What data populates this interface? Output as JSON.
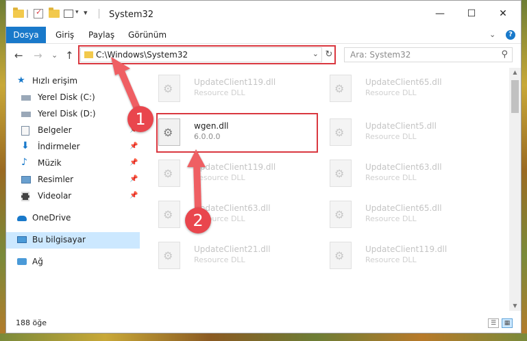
{
  "window": {
    "title": "System32",
    "controls": {
      "minimize": "—",
      "maximize": "☐",
      "close": "✕"
    }
  },
  "ribbon": {
    "tabs": [
      {
        "label": "Dosya",
        "active": true
      },
      {
        "label": "Giriş"
      },
      {
        "label": "Paylaş"
      },
      {
        "label": "Görünüm"
      }
    ],
    "expand_icon": "chevron-down-icon",
    "help_label": "?"
  },
  "nav": {
    "back_icon": "←",
    "forward_icon": "→",
    "recent_icon": "⌄",
    "up_icon": "↑",
    "address": "C:\\Windows\\System32",
    "refresh_icon": "↻",
    "search_placeholder": "Ara: System32",
    "search_icon": "⚲"
  },
  "sidebar": {
    "items": [
      {
        "label": "Hızlı erişim",
        "icon": "star-icon"
      },
      {
        "label": "Yerel Disk (C:)",
        "icon": "drive-icon"
      },
      {
        "label": "Yerel Disk (D:)",
        "icon": "drive-icon"
      },
      {
        "label": "Belgeler",
        "icon": "documents-icon",
        "pinned": true
      },
      {
        "label": "İndirmeler",
        "icon": "download-icon",
        "pinned": true
      },
      {
        "label": "Müzik",
        "icon": "music-icon",
        "pinned": true
      },
      {
        "label": "Resimler",
        "icon": "pictures-icon",
        "pinned": true
      },
      {
        "label": "Videolar",
        "icon": "videos-icon",
        "pinned": true
      },
      {
        "label": "OneDrive",
        "icon": "cloud-icon"
      },
      {
        "label": "Bu bilgisayar",
        "icon": "computer-icon",
        "selected": true
      },
      {
        "label": "Ağ",
        "icon": "network-icon"
      }
    ],
    "pin_glyph": "📌"
  },
  "files": [
    {
      "name": "UpdateClient119.dll",
      "desc": "Resource DLL"
    },
    {
      "name": "UpdateClient65.dll",
      "desc": "Resource DLL"
    },
    {
      "name": "wgen.dll",
      "desc": "6.0.0.0",
      "active": true
    },
    {
      "name": "UpdateClient5.dll",
      "desc": "Resource DLL"
    },
    {
      "name": "UpdateClient119.dll",
      "desc": "Resource DLL"
    },
    {
      "name": "UpdateClient63.dll",
      "desc": "Resource DLL"
    },
    {
      "name": "UpdateClient63.dll",
      "desc": "Resource DLL"
    },
    {
      "name": "UpdateClient65.dll",
      "desc": "Resource DLL"
    },
    {
      "name": "UpdateClient21.dll",
      "desc": "Resource DLL"
    },
    {
      "name": "UpdateClient119.dll",
      "desc": "Resource DLL"
    }
  ],
  "status": {
    "count": "188 öğe"
  },
  "annotations": {
    "step1": "1",
    "step2": "2",
    "accent": "#e9464d"
  },
  "colors": {
    "file_tab": "#1979ca",
    "highlight_box": "#d9363e",
    "selection": "#cce8ff"
  }
}
